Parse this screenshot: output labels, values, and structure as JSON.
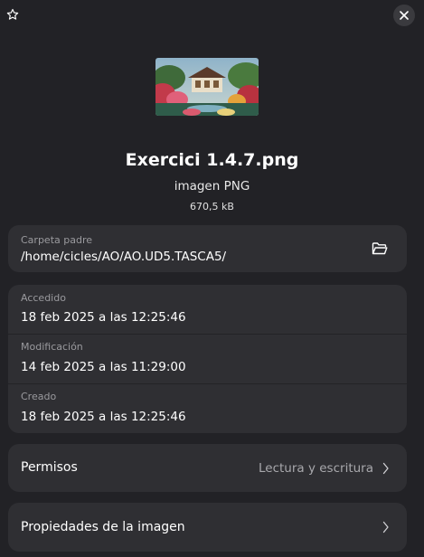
{
  "header": {
    "star_icon": "star-outline-icon",
    "close_icon": "close-icon"
  },
  "file": {
    "name": "Exercici 1.4.7.png",
    "type": "imagen PNG",
    "size": "670,5 kB"
  },
  "location": {
    "label": "Carpeta padre",
    "path": "/home/cicles/AO/AO.UD5.TASCA5/",
    "icon": "folder-open-icon"
  },
  "dates": [
    {
      "label": "Accedido",
      "value": "18 feb 2025 a las 12:25:46"
    },
    {
      "label": "Modificación",
      "value": "14 feb 2025 a las 11:29:00"
    },
    {
      "label": "Creado",
      "value": "18 feb 2025 a las 12:25:46"
    }
  ],
  "permissions": {
    "label": "Permisos",
    "value": "Lectura y escritura"
  },
  "image_properties": {
    "label": "Propiedades de la imagen"
  },
  "colors": {
    "background": "#222226",
    "card": "#2f2f33",
    "muted_text": "#9a9a9e"
  }
}
